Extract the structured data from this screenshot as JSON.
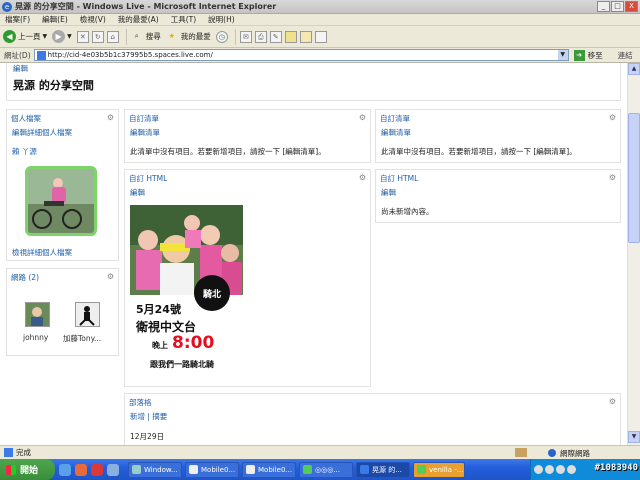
{
  "window": {
    "title": "晃源 的分享空間 - Windows Live - Microsoft Internet Explorer",
    "buttons": [
      "_",
      "□",
      "X"
    ]
  },
  "menu": [
    "檔案(F)",
    "編輯(E)",
    "檢視(V)",
    "我的最愛(A)",
    "工具(T)",
    "說明(H)"
  ],
  "toolbar": {
    "back_label": "上一頁",
    "search_label": "搜尋",
    "favorites_label": "我的最愛"
  },
  "address": {
    "label": "網址(D)",
    "url": "http://cid-4e03b5b1c37995b5.spaces.live.com/",
    "go_label": "移至",
    "links_label": "連結"
  },
  "page": {
    "edit_link": "編輯",
    "space_title": "晃源 的分享空間",
    "profile": {
      "title": "個人檔案",
      "edit_details": "編輯詳細個人檔案",
      "name": "賴 丫源",
      "view_details": "檢視詳細個人檔案"
    },
    "network": {
      "title": "網路 (2)",
      "contacts": [
        {
          "name": "johnny"
        },
        {
          "name": "加藤Tony..."
        }
      ]
    },
    "custom_list_1": {
      "title": "自訂清單",
      "edit_link": "編輯清單",
      "body": "此清單中沒有項目。若要新增項目，請按一下 [編輯清單]。"
    },
    "custom_list_2": {
      "title": "自訂清單",
      "edit_link": "編輯清單",
      "body": "此清單中沒有項目。若要新增項目，請按一下 [編輯清單]。"
    },
    "custom_html_1": {
      "title": "自訂 HTML",
      "edit_link": "編輯",
      "poster": {
        "date": "5月24號",
        "channel": "衛視中文台",
        "time_prefix": "晚上",
        "time": "8:00",
        "tagline": "跟我們一路騎北騎",
        "badge": "騎北"
      }
    },
    "custom_html_2": {
      "title": "自訂 HTML",
      "edit_link": "編輯",
      "body": "尚未新增內容。"
    },
    "blog": {
      "title": "部落格",
      "links": "新增 | 摘要",
      "date": "12月29日"
    }
  },
  "status": {
    "text": "完成",
    "zone": "網際網路"
  },
  "taskbar": {
    "start_label": "開始",
    "tasks": [
      {
        "label": "Window..."
      },
      {
        "label": "Mobile0..."
      },
      {
        "label": "Mobile0..."
      },
      {
        "label": "◎◎◎..."
      },
      {
        "label": "晃源 的..."
      },
      {
        "label": "venilla -..."
      }
    ],
    "watermark": "#1083940"
  }
}
